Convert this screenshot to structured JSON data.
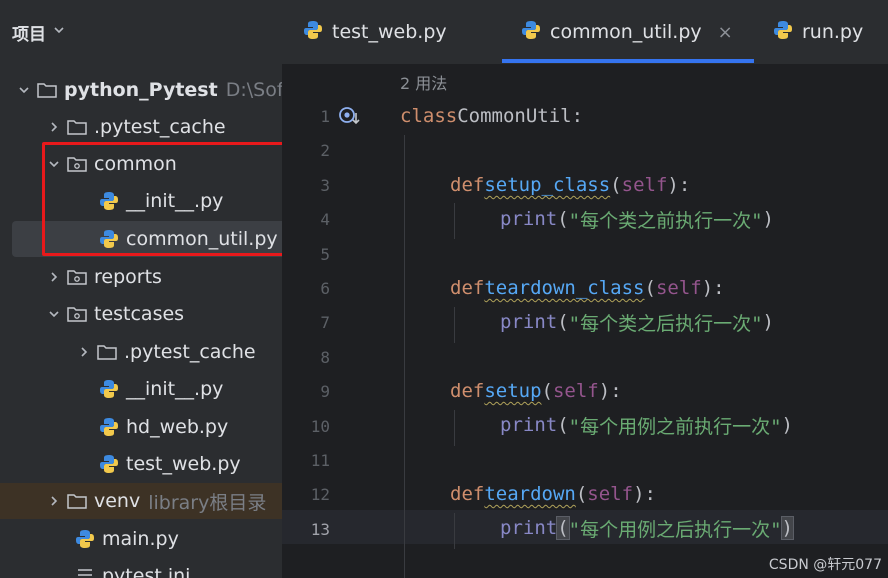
{
  "project_panel": {
    "title": "项目",
    "tree": [
      {
        "label": "python_Pytest",
        "hint": "D:\\Sof",
        "type": "folder",
        "expanded": true
      },
      {
        "label": ".pytest_cache",
        "type": "folder",
        "expanded": false
      },
      {
        "label": "common",
        "type": "package",
        "expanded": true
      },
      {
        "label": "__init__.py",
        "type": "python"
      },
      {
        "label": "common_util.py",
        "type": "python",
        "selected": true
      },
      {
        "label": "reports",
        "type": "package",
        "expanded": false
      },
      {
        "label": "testcases",
        "type": "package",
        "expanded": true
      },
      {
        "label": ".pytest_cache",
        "type": "folder",
        "expanded": false
      },
      {
        "label": "__init__.py",
        "type": "python"
      },
      {
        "label": "hd_web.py",
        "type": "python"
      },
      {
        "label": "test_web.py",
        "type": "python"
      },
      {
        "label": "venv",
        "hint": "library根目录",
        "type": "folder",
        "expanded": false
      },
      {
        "label": "main.py",
        "type": "python"
      },
      {
        "label": "pytest.ini",
        "type": "ini"
      }
    ]
  },
  "tabs": [
    {
      "label": "test_web.py",
      "active": false
    },
    {
      "label": "common_util.py",
      "active": true,
      "close": "×"
    },
    {
      "label": "run.py",
      "active": false
    }
  ],
  "editor": {
    "usage_hint": "2 用法",
    "line_numbers": [
      "1",
      "2",
      "3",
      "4",
      "5",
      "6",
      "7",
      "8",
      "9",
      "10",
      "11",
      "12",
      "13"
    ],
    "current_line": "13",
    "code": {
      "l1_kw": "class",
      "l1_name": "CommonUtil",
      "def": "def",
      "self": "self",
      "print": "print",
      "m1": "setup_class",
      "s1": "\"每个类之前执行一次\"",
      "m2": "teardown_class",
      "s2": "\"每个类之后执行一次\"",
      "m3": "setup",
      "s3": "\"每个用例之前执行一次\"",
      "m4": "teardown",
      "s4": "\"每个用例之后执行一次\""
    }
  },
  "watermark": "CSDN @轩元077",
  "colors": {
    "accent": "#3574f0",
    "highlight_box": "#e8191b",
    "keyword": "#cf8e6d",
    "function": "#56a8f5",
    "string": "#6aab73"
  }
}
